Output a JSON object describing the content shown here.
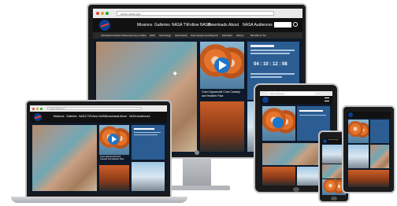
{
  "desktop": {
    "url": "www.nasa.gov",
    "nav": [
      "Missions",
      "Galleries",
      "NASA TV",
      "Follow NASA",
      "Downloads",
      "About",
      "NASA Audiences"
    ],
    "subnav": [
      "International Space Station",
      "Journey to Mars",
      "Earth",
      "Technology",
      "Aeronautics",
      "Solar System and Beyond",
      "Education",
      "History",
      "Benefits to You"
    ],
    "countdown": "04 : 10 : 12 : 08",
    "caption": "Orion Spacecraft Chris Cassidy and Heather Paul"
  },
  "laptop": {
    "url": "www.nasa.gov",
    "nav": [
      "Missions",
      "Galleries",
      "NASA TV",
      "Follow NASA",
      "Downloads",
      "About",
      "NASA Audiences"
    ],
    "caption": "Orion Spacecraft Chris Cassidy and Heather Paul"
  },
  "tablet": {
    "url": "www.nasa.gov"
  },
  "phone": {
    "url": "www.nasa.gov"
  },
  "colors": {
    "nasa_blue": "#0b3d91",
    "nasa_red": "#fc3d21",
    "panel_blue": "#2b5d92"
  }
}
